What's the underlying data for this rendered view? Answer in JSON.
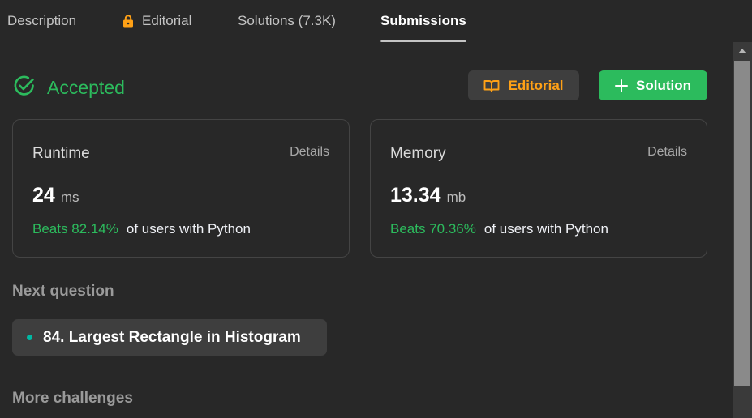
{
  "tabs": [
    {
      "label": "Description"
    },
    {
      "label": "Editorial",
      "icon": "lock-icon",
      "icon_color": "#ffa116"
    },
    {
      "label": "Solutions (7.3K)"
    },
    {
      "label": "Submissions",
      "active": true
    }
  ],
  "status": {
    "label": "Accepted",
    "color": "#2cbb5d",
    "icon": "check-circle-icon"
  },
  "actions": {
    "editorial_label": "Editorial",
    "editorial_icon": "book-icon",
    "solution_label": "Solution",
    "solution_icon": "plus-icon"
  },
  "runtime": {
    "title": "Runtime",
    "details": "Details",
    "value": "24",
    "unit": "ms",
    "beats": "Beats 82.14%",
    "beats_rest": "of users with Python"
  },
  "memory": {
    "title": "Memory",
    "details": "Details",
    "value": "13.34",
    "unit": "mb",
    "beats": "Beats 70.36%",
    "beats_rest": "of users with Python"
  },
  "next_question": {
    "heading": "Next question",
    "title": "84. Largest Rectangle in Histogram",
    "difficulty_color": "#00b8a3"
  },
  "more_challenges": {
    "heading": "More challenges"
  },
  "colors": {
    "accent_green": "#2cbb5d",
    "accent_orange": "#ffa116",
    "background": "#282828"
  }
}
